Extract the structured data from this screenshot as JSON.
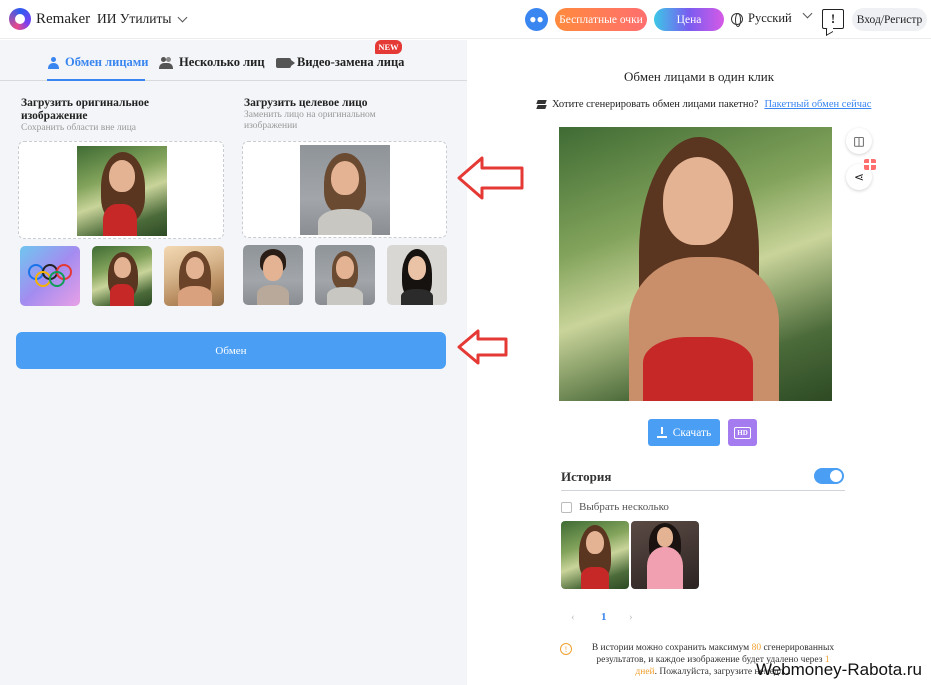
{
  "header": {
    "brand": "Remaker",
    "tools_menu": "ИИ Утилиты",
    "free_points": "Бесплатные очки",
    "price": "Цена",
    "language": "Русский",
    "feedback": "!",
    "login": "Вход/Регистр"
  },
  "tabs": [
    {
      "label": "Обмен лицами",
      "active": true
    },
    {
      "label": "Несколько лиц",
      "active": false
    },
    {
      "label": "Видео-замена лица",
      "active": false,
      "badge": "NEW"
    }
  ],
  "upload_original": {
    "title": "Загрузить оригинальное изображение",
    "subtitle": "Сохранить области вне лица"
  },
  "upload_target": {
    "title": "Загрузить целевое лицо",
    "subtitle": "Заменить лицо на оригинальном изображении"
  },
  "swap_button": "Обмен",
  "result": {
    "title": "Обмен лицами в один клик",
    "batch_question": "Хотите сгенерировать обмен лицами пакетно?",
    "batch_link": "Пакетный обмен сейчас",
    "download": "Скачать",
    "hd": "HD"
  },
  "history": {
    "title": "История",
    "select_multiple": "Выбрать несколько",
    "page": "1",
    "prev": "‹",
    "next": "›",
    "note_part1": "В истории можно сохранить максимум ",
    "note_max": "80",
    "note_part2": " сгенерированных результатов, и каждое изображение будет удалено через ",
    "note_days": "1 дней",
    "note_part3": ". Пожалуйста, загрузите немедл..."
  },
  "watermark": "Webmoney-Rabota.ru",
  "colors": {
    "accent": "#3a86f0",
    "swap_button": "#4a9ff5",
    "arrow": "#e53935",
    "badge": "#e53935"
  }
}
